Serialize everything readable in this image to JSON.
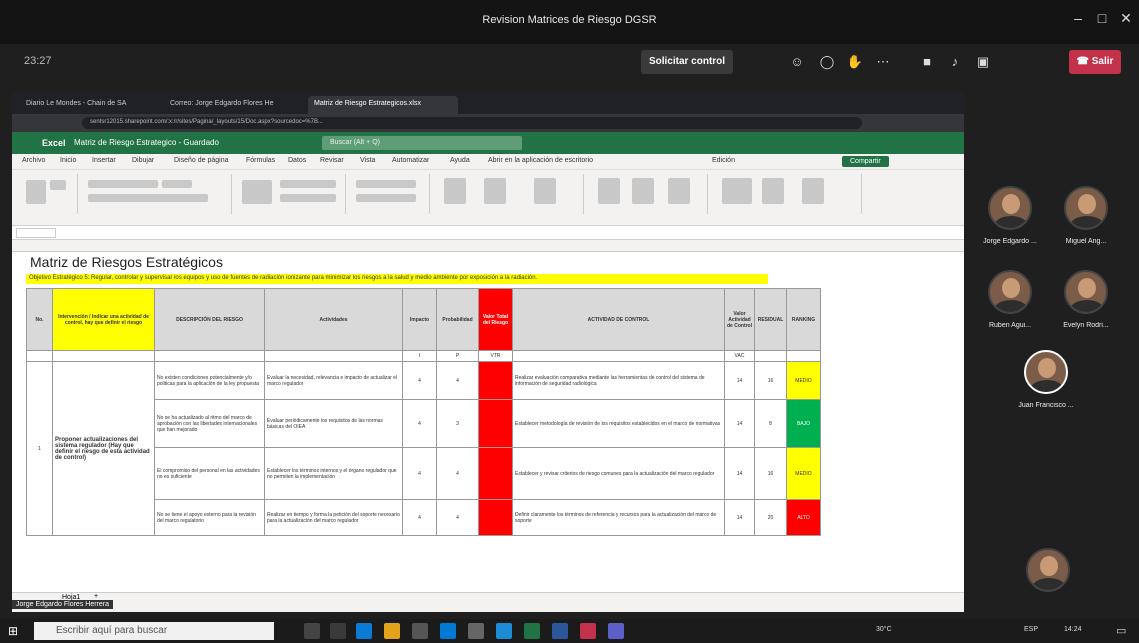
{
  "window": {
    "title": "Revision Matrices de Riesgo DGSR"
  },
  "meeting": {
    "elapsed": "23:27",
    "request_control": "Solicitar control",
    "leave": "Salir",
    "participants": [
      {
        "name": "Jorge Edgardo ..."
      },
      {
        "name": "Miguel Ang..."
      },
      {
        "name": "Ruben Agui..."
      },
      {
        "name": "Evelyn Rodri..."
      },
      {
        "name": "Juan Francisco ..."
      }
    ],
    "presenter_label": "Jorge Edgardo Flores Herrera"
  },
  "browser": {
    "tabs": [
      "Diario Le Mondes - Chain de SA",
      "Correo: Jorge Edgardo Flores He",
      "Matriz de Riesgo Estrategicos.xlsx"
    ],
    "address": "sentsr12015.sharepoint.com/:x:/r/sites/Pagina/_layouts/15/Doc.aspx?sourcedoc=%7B..."
  },
  "excel": {
    "app": "Excel",
    "doc": "Matriz de Riesgo Estrategico - Guardado",
    "search_placeholder": "Buscar (Alt + Q)",
    "menu": [
      "Archivo",
      "Inicio",
      "Insertar",
      "Dibujar",
      "Diseño de página",
      "Fórmulas",
      "Datos",
      "Revisar",
      "Vista",
      "Automatizar",
      "Ayuda",
      "Abrir en la aplicación de escritorio",
      "Edición"
    ],
    "share": "Compartir",
    "sheet_tab": "Hoja1"
  },
  "sheet": {
    "title": "Matriz de Riesgos Estratégicos",
    "objective": "Objetivo Estratégico 5: Regular, controlar y supervisar los equipos y uso de fuentes de radiación ionizante para minimizar los riesgos a la salud y medio ambiente por exposición a la radiación.",
    "headers": [
      "No.",
      "Intervención / Indicar una actividad de control, hay que definir el riesgo",
      "DESCRIPCIÓN DEL RIESGO",
      "Actividades",
      "Impacto",
      "Probabilidad",
      "Valor Total del Riesgo",
      "ACTIVIDAD DE CONTROL",
      "Valor Actividad de Control",
      "RESIDUAL",
      "RANKING"
    ],
    "sub": [
      "I",
      "P",
      "VTR",
      "VAC"
    ],
    "row_no": "1",
    "intervention": "Proponer actualizaciones del sistema regulador (Hay que definir el riesgo de esta actividad de control)",
    "rows": [
      {
        "desc": "No existen condiciones potencialmente y/o politicas para la aplicación de la ley propuesta",
        "act": "Evaluar la necesidad, relevancia e impacto de actualizar el marco regulador",
        "i": "4",
        "p": "4",
        "ctrl": "Realizar evaluación comparativa mediante las herramientas de control del sistema de información de seguridad radiológica",
        "vac": "14",
        "res": "16",
        "rank": "MEDIO",
        "lvl": "y"
      },
      {
        "desc": "No se ha actualizado al ritmo del marco de aprobación con las libertades internacionales que han mejorado",
        "act": "Evaluar periódicamente los requisitos de las normas básicas del OIEA",
        "i": "4",
        "p": "3",
        "ctrl": "Establecer metodología de revisión de los requisitos establecidos en el marco de normativas",
        "vac": "14",
        "res": "8",
        "rank": "BAJO",
        "lvl": "g"
      },
      {
        "desc": "El compromiso del personal en las actividades no es suficiente",
        "act": "Establecer los términos internos y el órgano regulador que no permiten la implementación",
        "i": "4",
        "p": "4",
        "ctrl": "Establecer y revisar criterios de riesgo comunes para la actualización del marco regulador",
        "vac": "14",
        "res": "16",
        "rank": "MEDIO",
        "lvl": "y"
      },
      {
        "desc": "No se tiene el apoyo externo para la revisión del marco regulatorio",
        "act": "Realizar en tiempo y forma la petición del soporte necesario para la actualización del marco regulador",
        "i": "4",
        "p": "4",
        "ctrl": "Definir claramente los términos de referencia y recursos para la actualización del marco de soporte",
        "vac": "14",
        "res": "20",
        "rank": "ALTO",
        "lvl": "r"
      }
    ]
  },
  "taskbar": {
    "search_placeholder": "Escribir aquí para buscar",
    "weather": "30°C",
    "clock": "14:24",
    "lang": "ESP"
  },
  "colors": {
    "excel_green": "#217346",
    "leave_red": "#c4314b"
  }
}
